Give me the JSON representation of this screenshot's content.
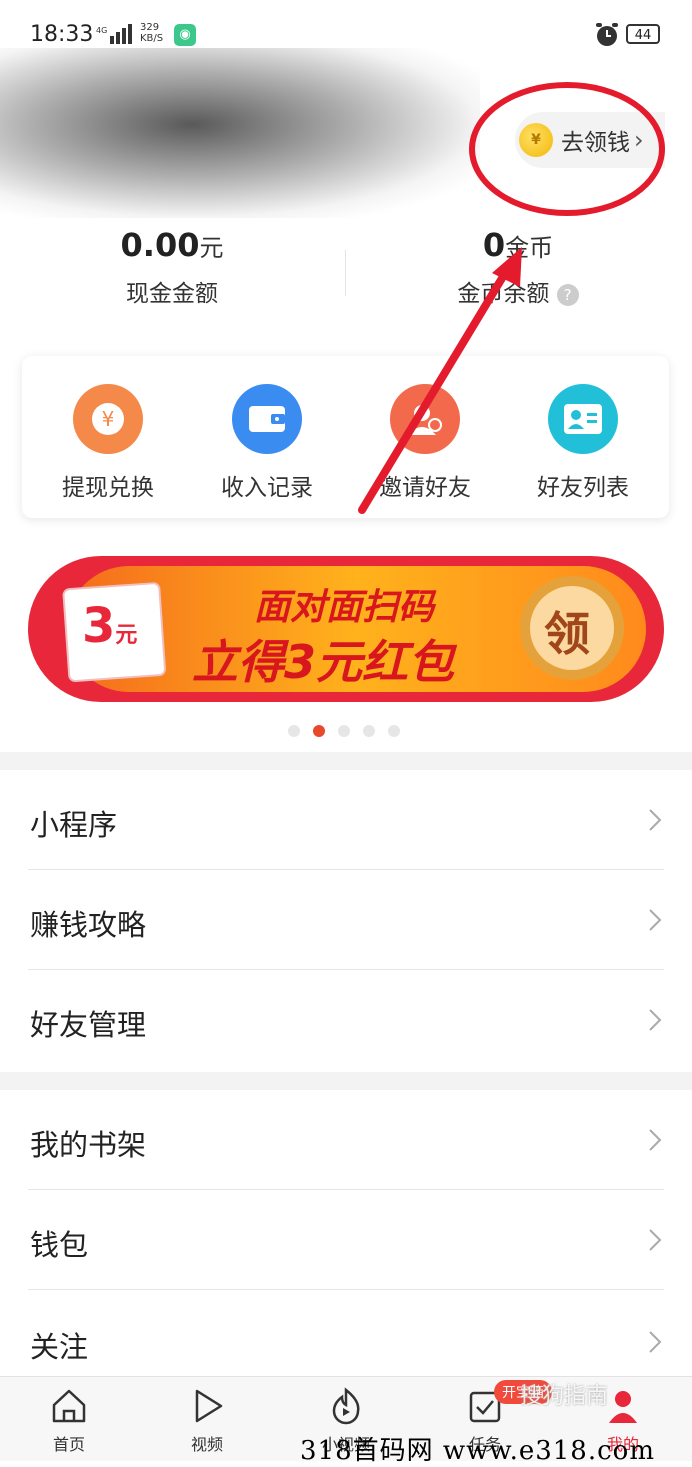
{
  "status_bar": {
    "time": "18:33",
    "network": "4G",
    "speed_value": "329",
    "speed_unit": "KB/S",
    "battery": "44"
  },
  "header": {
    "claim_button_label": "去领钱",
    "claim_chevron": "›",
    "coin_glyph": "¥"
  },
  "balances": {
    "cash": {
      "value": "0.00",
      "unit": "元",
      "label": "现金金额"
    },
    "coins": {
      "value": "0",
      "unit": "金币",
      "label": "金币余额",
      "help_glyph": "?"
    }
  },
  "quick_actions": [
    {
      "label": "提现兑换",
      "icon": "yuan-icon",
      "color": "#f5894a"
    },
    {
      "label": "收入记录",
      "icon": "wallet-icon",
      "color": "#3b8cf0"
    },
    {
      "label": "邀请好友",
      "icon": "invite-icon",
      "color": "#f26a4b"
    },
    {
      "label": "好友列表",
      "icon": "contacts-icon",
      "color": "#22c0d8"
    }
  ],
  "banner": {
    "ticket_amount": "3",
    "ticket_unit": "元",
    "line1": "面对面扫码",
    "line2": "立得3元红包",
    "claim_label": "领",
    "active_index": 1,
    "count": 5
  },
  "menu_group_1": [
    {
      "label": "小程序"
    },
    {
      "label": "赚钱攻略"
    },
    {
      "label": "好友管理"
    }
  ],
  "menu_group_2": [
    {
      "label": "我的书架"
    },
    {
      "label": "钱包"
    },
    {
      "label": "关注"
    }
  ],
  "tabbar": [
    {
      "label": "首页",
      "icon": "home-icon"
    },
    {
      "label": "视频",
      "icon": "play-icon"
    },
    {
      "label": "小视频",
      "icon": "short-video-icon"
    },
    {
      "label": "任务",
      "icon": "task-icon",
      "badge": "开宝箱"
    },
    {
      "label": "我的",
      "icon": "profile-icon"
    }
  ],
  "watermarks": {
    "sogou": "搜狗指南",
    "site": "318首码网 www.e318.com"
  },
  "colors": {
    "accent_red": "#e41b2c",
    "brand_red": "#f04a3c"
  }
}
